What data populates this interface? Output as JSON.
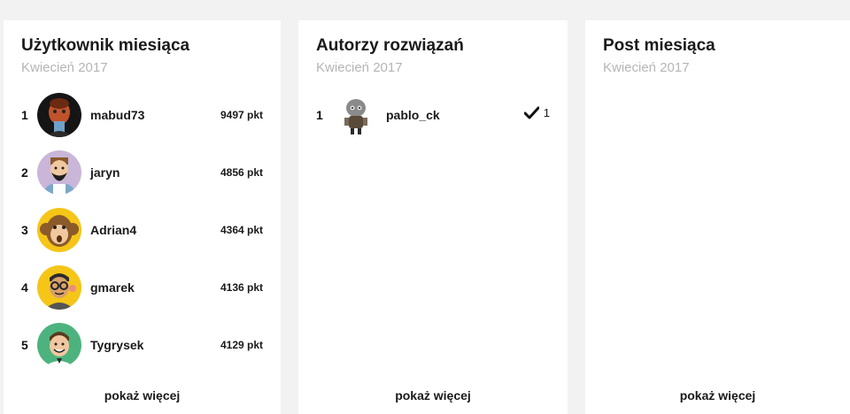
{
  "user_of_month": {
    "title": "Użytkownik miesiąca",
    "subtitle": "Kwiecień 2017",
    "users": [
      {
        "rank": "1",
        "name": "mabud73",
        "points": "9497 pkt",
        "avatar": "dark-portrait-icon"
      },
      {
        "rank": "2",
        "name": "jaryn",
        "points": "4856 pkt",
        "avatar": "bearded-man-icon"
      },
      {
        "rank": "3",
        "name": "Adrian4",
        "points": "4364 pkt",
        "avatar": "monkey-icon"
      },
      {
        "rank": "4",
        "name": "gmarek",
        "points": "4136 pkt",
        "avatar": "glasses-man-icon"
      },
      {
        "rank": "5",
        "name": "Tygrysek",
        "points": "4129 pkt",
        "avatar": "smiling-man-icon"
      }
    ],
    "more_label": "pokaż więcej"
  },
  "solution_authors": {
    "title": "Autorzy rozwiązań",
    "subtitle": "Kwiecień 2017",
    "authors": [
      {
        "rank": "1",
        "name": "pablo_ck",
        "solutions": "1",
        "avatar": "robot-figure-icon"
      }
    ],
    "more_label": "pokaż więcej"
  },
  "post_of_month": {
    "title": "Post miesiąca",
    "subtitle": "Kwiecień 2017",
    "more_label": "pokaż więcej"
  },
  "colors": {
    "background": "#f2f2f2",
    "card": "#ffffff",
    "subtitle": "#b5b5b5"
  }
}
